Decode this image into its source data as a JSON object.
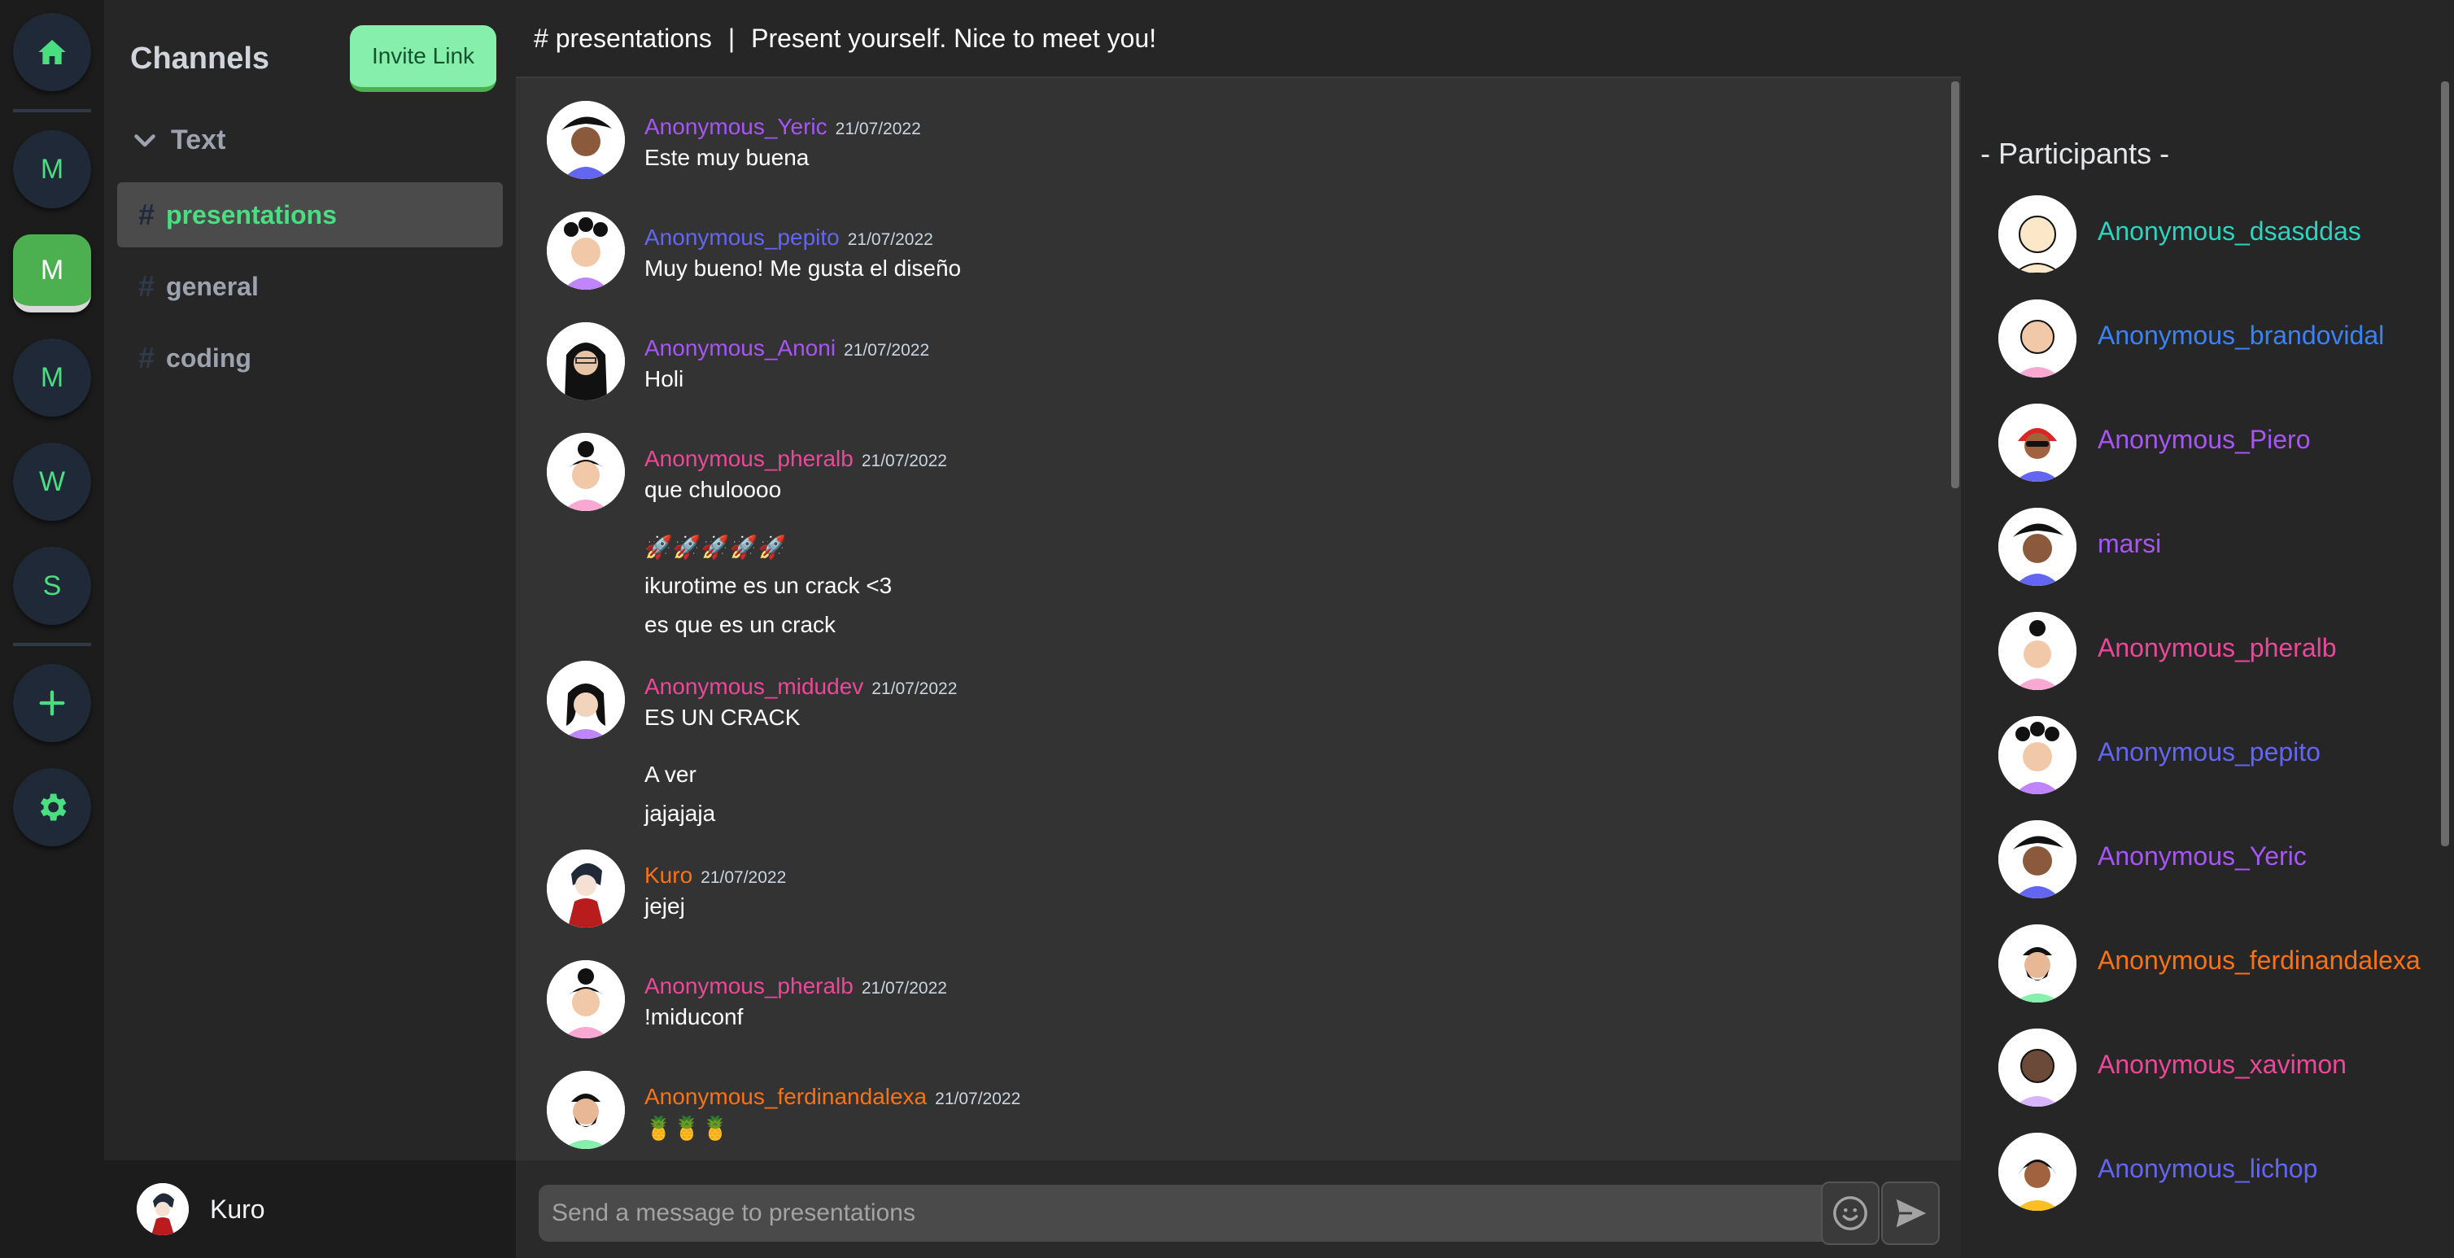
{
  "rail": {
    "servers": [
      "M",
      "M",
      "M",
      "W",
      "S"
    ],
    "active_index": 1,
    "accent": "#4ade80",
    "icons": [
      "home-icon",
      "plus-icon",
      "gear-icon"
    ]
  },
  "sidebar": {
    "title": "Channels",
    "invite_label": "Invite Link",
    "category": "Text",
    "channels": [
      {
        "name": "presentations",
        "active": true
      },
      {
        "name": "general",
        "active": false
      },
      {
        "name": "coding",
        "active": false
      }
    ],
    "hash": "#",
    "user": "Kuro"
  },
  "chat": {
    "header_channel": "# presentations",
    "header_sep": "|",
    "header_topic": "Present yourself. Nice to meet you!",
    "messages": [
      {
        "author": "Anonymous_Yeric",
        "date": "21/07/2022",
        "text": "Este muy buena",
        "color": "#a855f7"
      },
      {
        "author": "Anonymous_pepito",
        "date": "21/07/2022",
        "text": "Muy bueno! Me gusta el diseño",
        "color": "#6366f1"
      },
      {
        "author": "Anonymous_Anoni",
        "date": "21/07/2022",
        "text": "Holi",
        "color": "#a855f7"
      },
      {
        "author": "Anonymous_pheralb",
        "date": "21/07/2022",
        "text": "que chuloooo",
        "color": "#ec4899"
      },
      {
        "author": "Anonymous_midudev",
        "date": "21/07/2022",
        "text": "ES UN CRACK",
        "color": "#ec4899"
      },
      {
        "author": "Kuro",
        "date": "21/07/2022",
        "text": "jejej",
        "color": "#f97316"
      },
      {
        "author": "Anonymous_pheralb",
        "date": "21/07/2022",
        "text": "!miduconf",
        "color": "#ec4899"
      },
      {
        "author": "Anonymous_ferdinandalexa",
        "date": "21/07/2022",
        "text": "🍍🍍🍍",
        "color": "#f97316"
      }
    ],
    "continuations": [
      "🚀🚀🚀🚀🚀",
      "ikurotime es un crack <3",
      "es que es un crack",
      "A ver",
      "jajajaja"
    ],
    "input_placeholder": "Send a message to presentations"
  },
  "participants": {
    "title": "- Participants -",
    "list": [
      {
        "name": "Anonymous_dsasddas",
        "color": "#2dd4bf"
      },
      {
        "name": "Anonymous_brandovidal",
        "color": "#3b82f6"
      },
      {
        "name": "Anonymous_Piero",
        "color": "#a855f7"
      },
      {
        "name": "marsi",
        "color": "#a855f7"
      },
      {
        "name": "Anonymous_pheralb",
        "color": "#ec4899"
      },
      {
        "name": "Anonymous_pepito",
        "color": "#6366f1"
      },
      {
        "name": "Anonymous_Yeric",
        "color": "#a855f7"
      },
      {
        "name": "Anonymous_ferdinandalexa",
        "color": "#f97316"
      },
      {
        "name": "Anonymous_xavimon",
        "color": "#ec4899"
      },
      {
        "name": "Anonymous_lichop",
        "color": "#6366f1"
      }
    ]
  }
}
